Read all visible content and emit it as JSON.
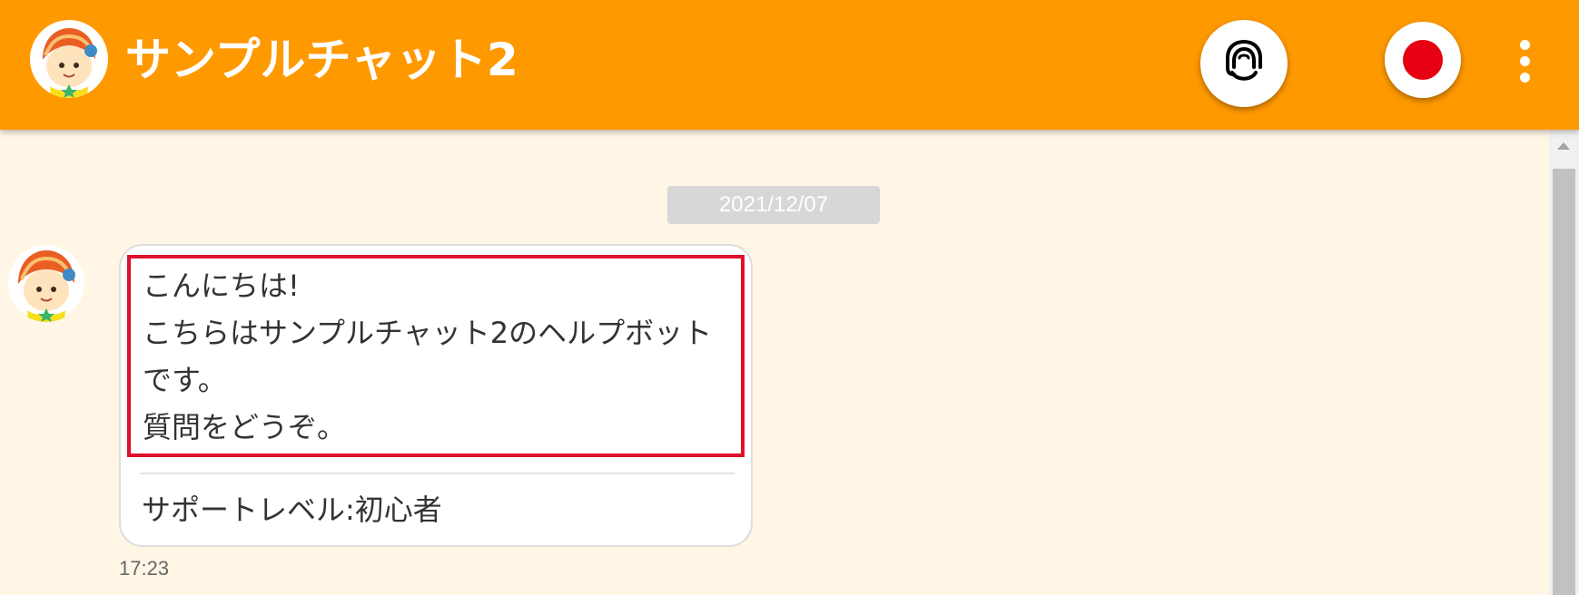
{
  "header": {
    "title": "サンプルチャット2",
    "avatar_icon": "chatbot-avatar-icon",
    "operator_icon": "operator-headset-icon",
    "record_icon": "record-dot-icon",
    "more_icon": "more-vertical-icon",
    "background_color": "#ff9900"
  },
  "chat": {
    "date": "2021/12/07",
    "messages": [
      {
        "sender_icon": "chatbot-avatar-icon",
        "lines": [
          "こんにちは!",
          "こちらはサンプルチャット2のヘルプボット",
          "です。",
          "質問をどうぞ。"
        ],
        "support_level": "サポートレベル:初心者",
        "time": "17:23"
      }
    ]
  },
  "colors": {
    "accent": "#ff9900",
    "background": "#fff6e6",
    "highlight": "#e10f2b",
    "record_red": "#e60012",
    "date_badge": "#d7d7d7"
  }
}
